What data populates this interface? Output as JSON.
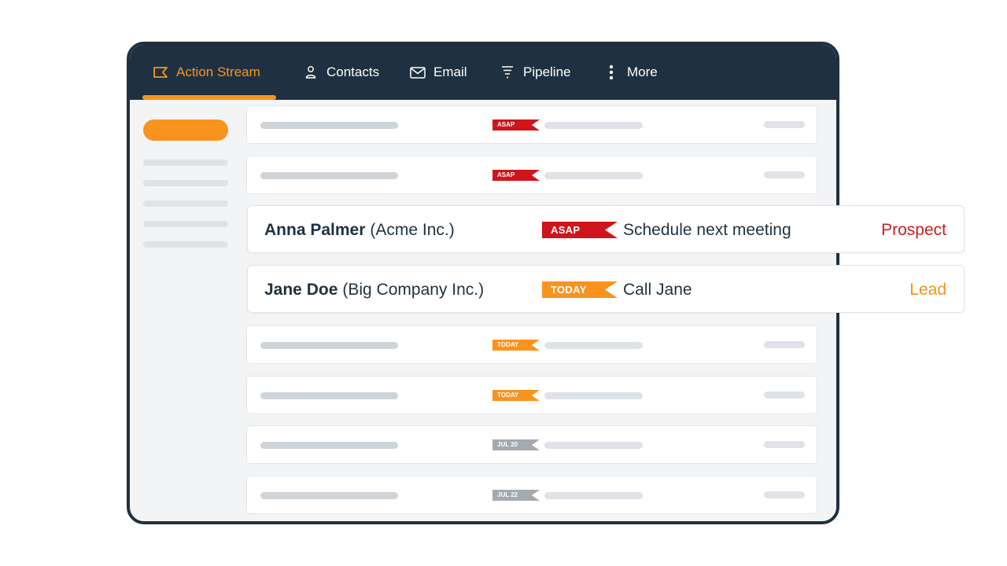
{
  "nav": {
    "items": [
      {
        "label": "Action Stream",
        "icon": "action-stream-icon",
        "active": true
      },
      {
        "label": "Contacts",
        "icon": "person-icon",
        "active": false
      },
      {
        "label": "Email",
        "icon": "envelope-icon",
        "active": false
      },
      {
        "label": "Pipeline",
        "icon": "funnel-icon",
        "active": false
      },
      {
        "label": "More",
        "icon": "vertical-dots-icon",
        "active": false
      }
    ]
  },
  "rows": {
    "mini_flags": [
      "ASAP",
      "ASAP",
      "TODAY",
      "TODAY",
      "JUL 20",
      "JUL 22"
    ],
    "anna": {
      "name": "Anna Palmer",
      "company": "(Acme Inc.)",
      "flag": "ASAP",
      "task": "Schedule next meeting",
      "status": "Prospect"
    },
    "jane": {
      "name": "Jane Doe",
      "company": "(Big Company Inc.)",
      "flag": "TODAY",
      "task": "Call Jane",
      "status": "Lead"
    }
  },
  "colors": {
    "navbar": "#1f3140",
    "accent": "#f8941e",
    "asap": "#d0141b",
    "today": "#f8941e",
    "date": "#a5aab0",
    "prospect": "#c81e1e",
    "lead": "#f0931e"
  }
}
